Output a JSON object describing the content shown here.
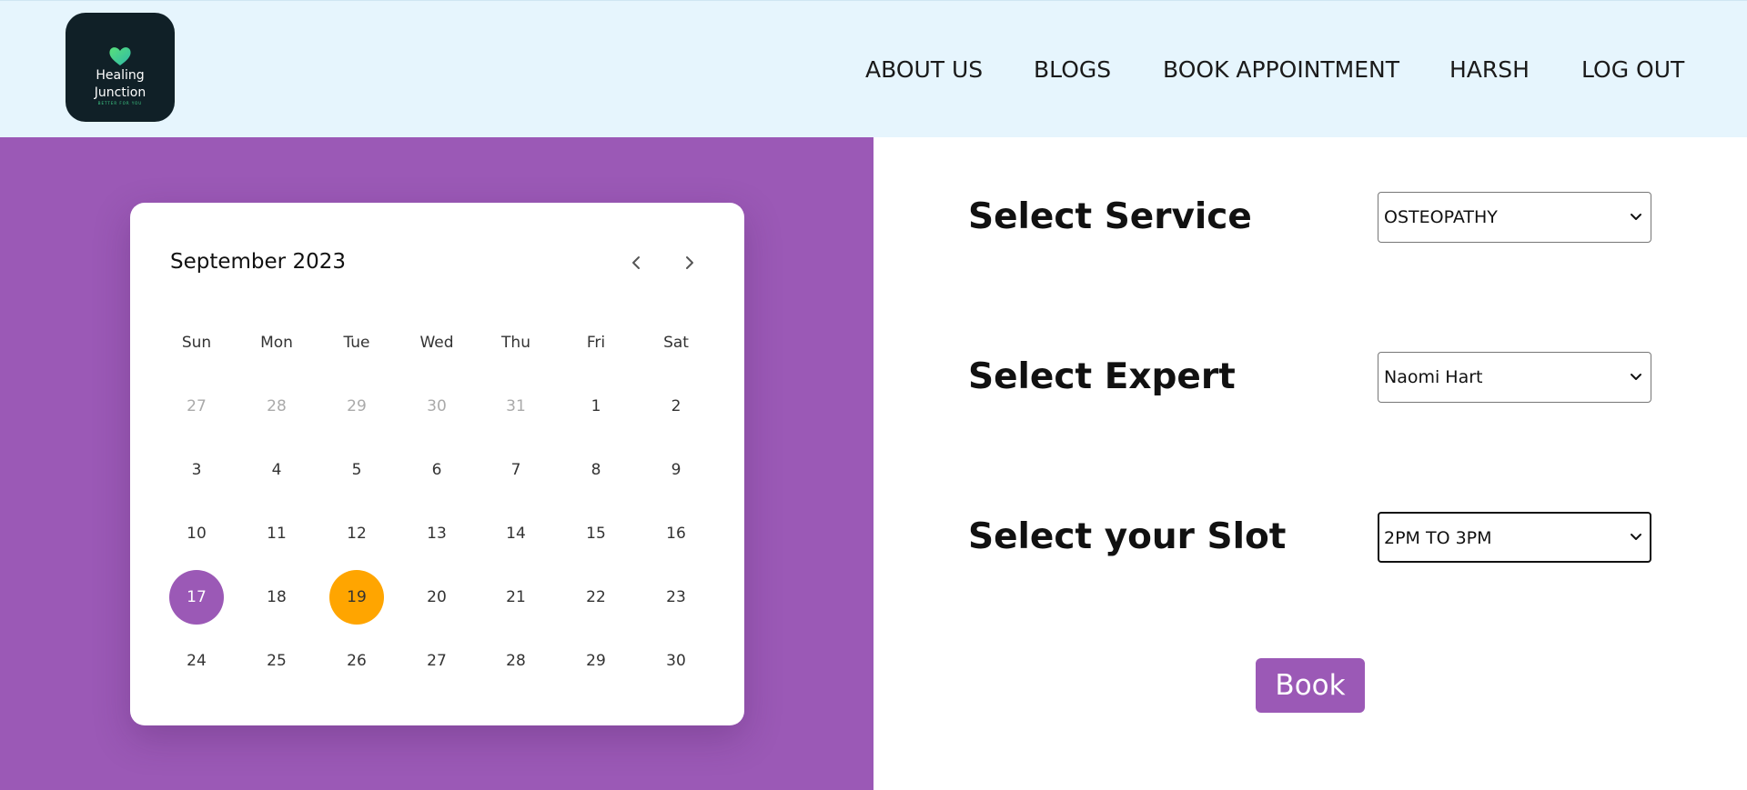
{
  "header": {
    "logo": {
      "line1": "Healing",
      "line2": "Junction",
      "tagline": "BETTER FOR YOU"
    },
    "nav": [
      {
        "label": "ABOUT US"
      },
      {
        "label": "BLOGS"
      },
      {
        "label": "BOOK APPOINTMENT"
      },
      {
        "label": "HARSH"
      },
      {
        "label": "LOG OUT"
      }
    ]
  },
  "calendar": {
    "month_label": "September 2023",
    "prev_icon": "chevron-left-icon",
    "next_icon": "chevron-right-icon",
    "weekdays": [
      "Sun",
      "Mon",
      "Tue",
      "Wed",
      "Thu",
      "Fri",
      "Sat"
    ],
    "weeks": [
      [
        "27",
        "28",
        "29",
        "30",
        "31",
        "1",
        "2"
      ],
      [
        "3",
        "4",
        "5",
        "6",
        "7",
        "8",
        "9"
      ],
      [
        "10",
        "11",
        "12",
        "13",
        "14",
        "15",
        "16"
      ],
      [
        "17",
        "18",
        "19",
        "20",
        "21",
        "22",
        "23"
      ],
      [
        "24",
        "25",
        "26",
        "27",
        "28",
        "29",
        "30"
      ]
    ],
    "muted_days_in_first_week": 5,
    "selected_day": "17",
    "today_day": "19",
    "colors": {
      "selected": "#9b59b6",
      "today": "#ffa500"
    }
  },
  "form": {
    "service": {
      "label": "Select Service",
      "value": "OSTEOPATHY"
    },
    "expert": {
      "label": "Select Expert",
      "value": "Naomi Hart"
    },
    "slot": {
      "label": "Select your Slot",
      "value": "2PM TO 3PM"
    },
    "book_label": "Book"
  },
  "colors": {
    "header_bg": "#e6f5fd",
    "panel_bg": "#9b59b6",
    "accent": "#9b59b6"
  }
}
